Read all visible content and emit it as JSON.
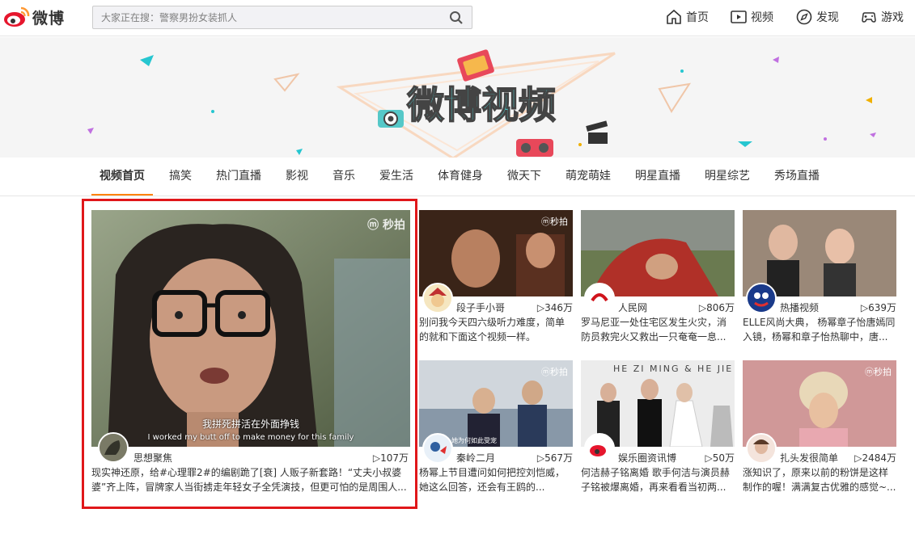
{
  "header": {
    "logo_text": "微博",
    "search_placeholder": "大家正在搜：警察男扮女装抓人",
    "nav": [
      {
        "label": "首页",
        "icon": "home-icon"
      },
      {
        "label": "视频",
        "icon": "video-icon"
      },
      {
        "label": "发现",
        "icon": "compass-icon"
      },
      {
        "label": "游戏",
        "icon": "gamepad-icon"
      }
    ]
  },
  "banner": {
    "title": "微博视频"
  },
  "tabs": [
    "视频首页",
    "搞笑",
    "热门直播",
    "影视",
    "音乐",
    "爱生活",
    "体育健身",
    "微天下",
    "萌宠萌娃",
    "明星直播",
    "明星综艺",
    "秀场直播"
  ],
  "featured": {
    "user": "思想聚焦",
    "plays": "▷107万",
    "subtitle_cn": "我拼死拼活在外面挣钱",
    "subtitle_en": "I worked my butt off to make money for this family",
    "desc": "现实神还原，给#心理罪2#的编剧跪了[衰] 人贩子新套路！“丈夫小叔婆婆”齐上阵，冒牌家人当街掳走年轻女子全凭演技，但更可怕的是周围人..."
  },
  "videos": [
    {
      "user": "段子手小哥",
      "plays": "▷346万",
      "desc": "别问我今天四六级听力难度，简单的就和下面这个视频一样。 http://..."
    },
    {
      "user": "人民网",
      "plays": "▷806万",
      "desc": "罗马尼亚一处住宅区发生火灾，消防员救完火又救出一只奄奄一息..."
    },
    {
      "user": "热播视频",
      "plays": "▷639万",
      "desc": "ELLE风尚大典， 杨幂章子怡唐嫣同入镜，杨幂和章子怡热聊中，唐..."
    },
    {
      "user": "秦岭二月",
      "plays": "▷567万",
      "desc": "杨幂上节目遭问如何把控刘恺威，她这么回答，还会有王鸥的..."
    },
    {
      "user": "娱乐圈资讯博",
      "plays": "▷50万",
      "desc": "何洁赫子铭离婚 歌手何洁与演员赫子铭被爆离婚，再来看看当初两..."
    },
    {
      "user": "扎头发很简单",
      "plays": "▷2484万",
      "desc": "涨知识了，原来以前的粉饼是这样制作的喔！满满复古优雅的感觉~..."
    }
  ],
  "watermarks": {
    "miaopai": "秒拍",
    "thumb6_caption": "她为何如此受宠",
    "wedding_text": "HE ZI MING & HE JIE"
  },
  "colors": {
    "accent": "#ff8200",
    "highlight": "#e0171a",
    "link": "#333333"
  }
}
